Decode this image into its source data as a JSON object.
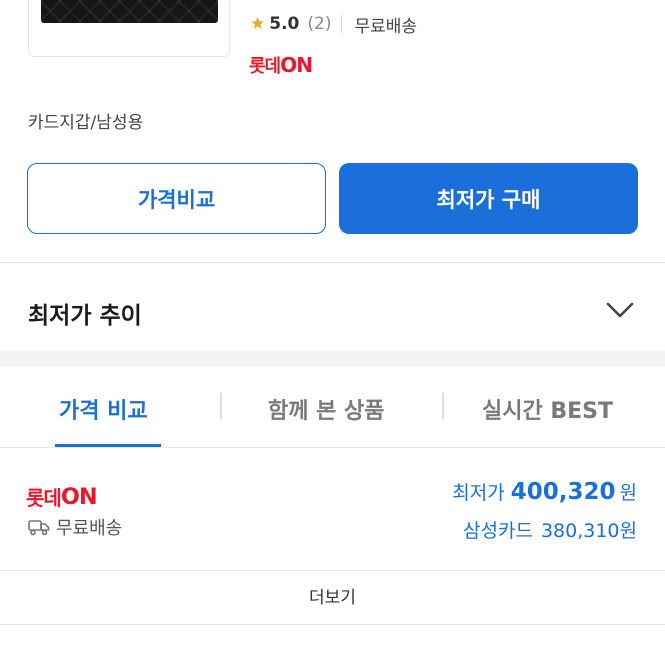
{
  "product": {
    "rating_star": "★",
    "rating": "5.0",
    "review_count": "(2)",
    "shipping": "무료배송",
    "seller_logo": {
      "prefix": "롯데",
      "suffix": "ON"
    },
    "category": "카드지갑/남성용"
  },
  "actions": {
    "compare_label": "가격비교",
    "buy_label": "최저가 구매"
  },
  "trend": {
    "title": "최저가 추이"
  },
  "tabs": [
    {
      "label": "가격 비교",
      "active": true
    },
    {
      "label": "함께 본 상품",
      "active": false
    },
    {
      "label": "실시간 BEST",
      "active": false
    }
  ],
  "offer": {
    "seller_logo": {
      "prefix": "롯데",
      "suffix": "ON"
    },
    "shipping": "무료배송",
    "lowest_label": "최저가",
    "lowest_price": "400,320",
    "lowest_unit": "원",
    "card_label": "삼성카드",
    "card_price": "380,310원"
  },
  "more_label": "더보기",
  "colors": {
    "accent": "#1a6fdb",
    "lotte_red": "#e8192c",
    "star": "#f5a623"
  }
}
